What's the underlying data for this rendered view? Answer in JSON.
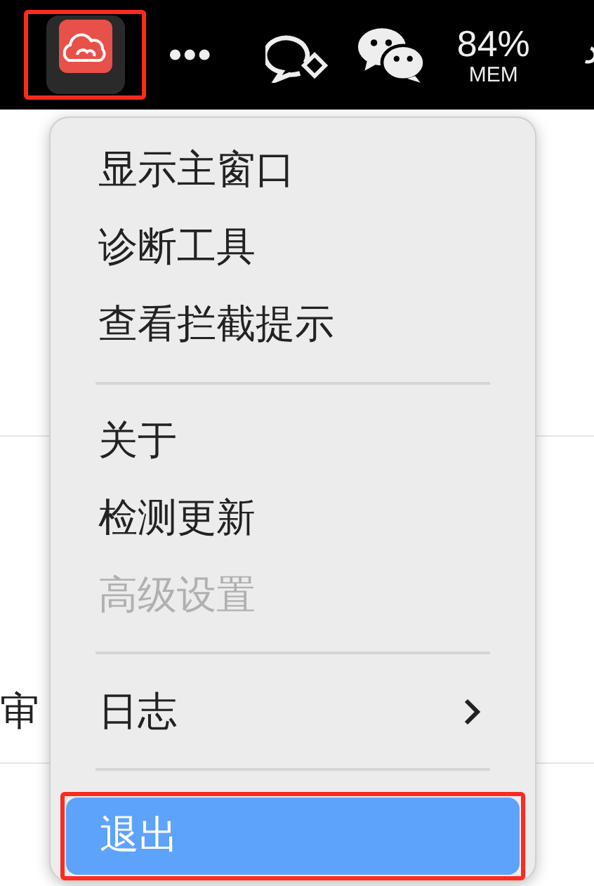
{
  "menu_bar": {
    "app_icon": {
      "highlighted": true
    },
    "memory": {
      "value": "84%",
      "label": "MEM"
    }
  },
  "background": {
    "text": "审"
  },
  "menu": {
    "items": [
      {
        "kind": "item",
        "label": "显示主窗口",
        "selected": false
      },
      {
        "kind": "item",
        "label": "诊断工具",
        "selected": false
      },
      {
        "kind": "item",
        "label": "查看拦截提示",
        "selected": false
      },
      {
        "kind": "divider"
      },
      {
        "kind": "item",
        "label": "关于",
        "selected": false
      },
      {
        "kind": "item",
        "label": "检测更新",
        "selected": false
      },
      {
        "kind": "item",
        "label": "高级设置",
        "selected": false,
        "disabled": true
      },
      {
        "kind": "divider"
      },
      {
        "kind": "item",
        "label": "日志",
        "selected": false,
        "submenu": true
      },
      {
        "kind": "divider"
      },
      {
        "kind": "item",
        "label": "退出",
        "selected": true,
        "highlighted": true
      }
    ]
  }
}
